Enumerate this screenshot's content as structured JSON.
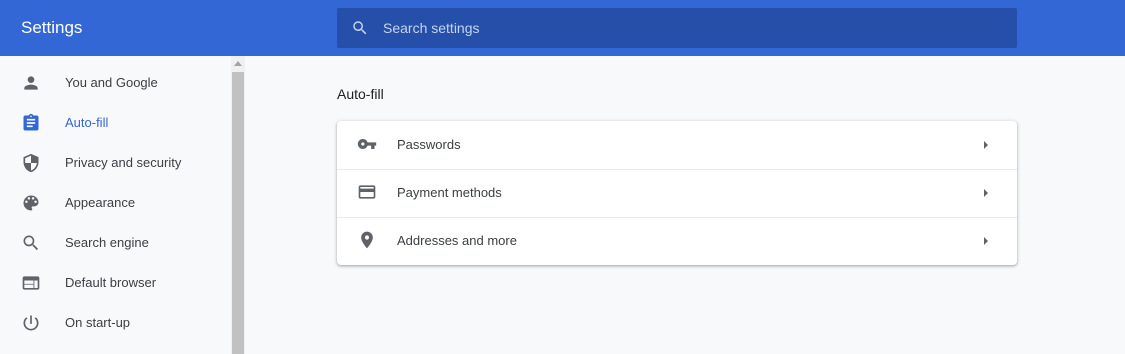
{
  "header": {
    "title": "Settings",
    "search_placeholder": "Search settings",
    "search_value": ""
  },
  "sidebar": {
    "items": [
      {
        "label": "You and Google",
        "icon": "person-icon",
        "selected": false
      },
      {
        "label": "Auto-fill",
        "icon": "clipboard-icon",
        "selected": true
      },
      {
        "label": "Privacy and security",
        "icon": "shield-icon",
        "selected": false
      },
      {
        "label": "Appearance",
        "icon": "palette-icon",
        "selected": false
      },
      {
        "label": "Search engine",
        "icon": "search-icon",
        "selected": false
      },
      {
        "label": "Default browser",
        "icon": "browser-icon",
        "selected": false
      },
      {
        "label": "On start-up",
        "icon": "power-icon",
        "selected": false
      }
    ]
  },
  "main": {
    "section_title": "Auto-fill",
    "rows": [
      {
        "label": "Passwords",
        "icon": "key-icon"
      },
      {
        "label": "Payment methods",
        "icon": "credit-card-icon"
      },
      {
        "label": "Addresses and more",
        "icon": "location-pin-icon"
      }
    ]
  },
  "colors": {
    "header_bg": "#3367d6",
    "search_bg": "#254fa8",
    "selected_accent": "#3367d6",
    "page_bg": "#f8f9fa",
    "icon_gray": "#5f6368"
  }
}
